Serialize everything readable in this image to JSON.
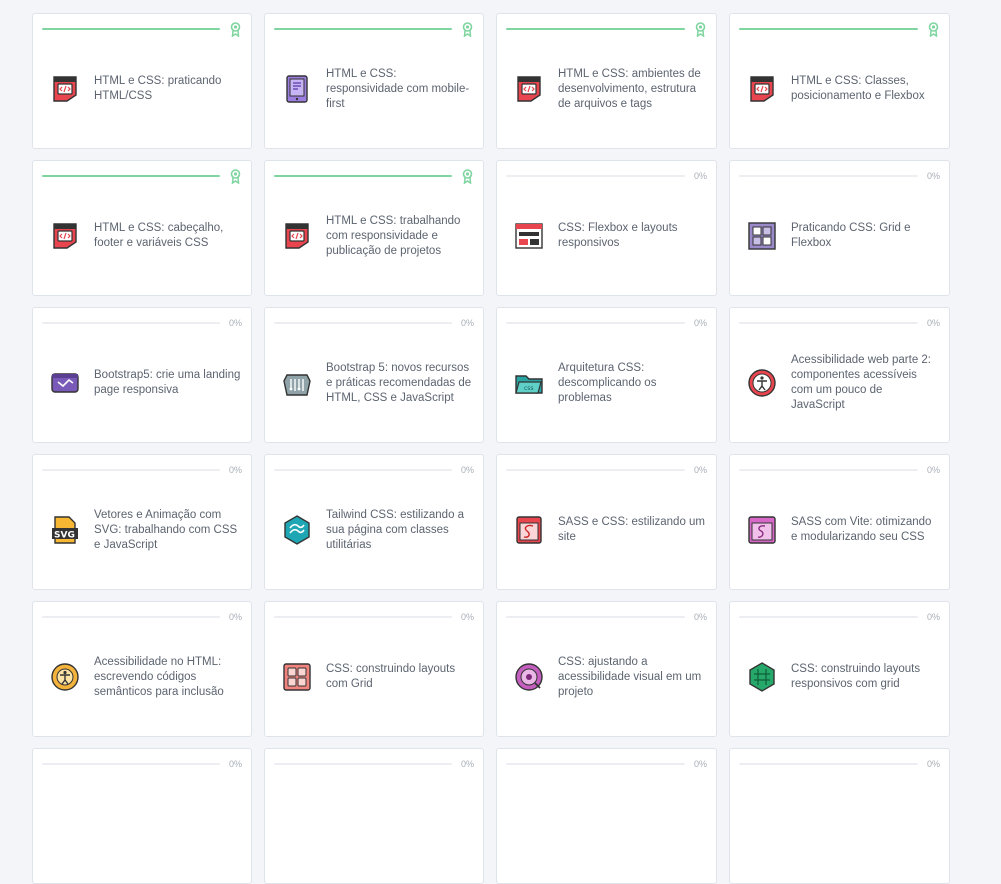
{
  "colors": {
    "progress_fill": "#7fd5a0",
    "track": "#eceef2",
    "percent_text": "#a7aeb8",
    "title_text": "#5c6470"
  },
  "courses": [
    {
      "title": "HTML e CSS: praticando HTML/CSS",
      "progress": 1,
      "percent": "",
      "icon": "html-code-icon",
      "completed": true
    },
    {
      "title": "HTML e CSS: responsividade com mobile-first",
      "progress": 1,
      "percent": "",
      "icon": "mobile-html-icon",
      "completed": true
    },
    {
      "title": "HTML e CSS: ambientes de desenvolvimento, estrutura de arquivos e tags",
      "progress": 1,
      "percent": "",
      "icon": "html-code-icon",
      "completed": true
    },
    {
      "title": "HTML e CSS: Classes, posicionamento e Flexbox",
      "progress": 1,
      "percent": "",
      "icon": "html-code-icon",
      "completed": true
    },
    {
      "title": "HTML e CSS: cabeçalho, footer e variáveis CSS",
      "progress": 1,
      "percent": "",
      "icon": "html-code-icon",
      "completed": true
    },
    {
      "title": "HTML e CSS: trabalhando com responsividade e publicação de projetos",
      "progress": 1,
      "percent": "",
      "icon": "html-code-icon",
      "completed": true
    },
    {
      "title": "CSS: Flexbox e layouts responsivos",
      "progress": 0,
      "percent": "0%",
      "icon": "layout-icon",
      "completed": false
    },
    {
      "title": "Praticando CSS: Grid e Flexbox",
      "progress": 0,
      "percent": "0%",
      "icon": "grid-flexbox-icon",
      "completed": false
    },
    {
      "title": "Bootstrap5: crie uma landing page responsiva",
      "progress": 0,
      "percent": "0%",
      "icon": "bootstrap-icon",
      "completed": false
    },
    {
      "title": "Bootstrap 5: novos recursos e práticas recomendadas de HTML, CSS e JavaScript",
      "progress": 0,
      "percent": "0%",
      "icon": "circuit-icon",
      "completed": false
    },
    {
      "title": "Arquitetura CSS: descomplicando os problemas",
      "progress": 0,
      "percent": "0%",
      "icon": "css-folder-icon",
      "completed": false
    },
    {
      "title": "Acessibilidade web parte 2: componentes acessíveis com um pouco de JavaScript",
      "progress": 0,
      "percent": "0%",
      "icon": "accessibility-person-icon",
      "completed": false
    },
    {
      "title": "Vetores e Animação com SVG: trabalhando com CSS e JavaScript",
      "progress": 0,
      "percent": "0%",
      "icon": "svg-file-icon",
      "completed": false
    },
    {
      "title": "Tailwind CSS: estilizando a sua página com classes utilitárias",
      "progress": 0,
      "percent": "0%",
      "icon": "tailwind-icon",
      "completed": false
    },
    {
      "title": "SASS e CSS: estilizando um site",
      "progress": 0,
      "percent": "0%",
      "icon": "sass-window-icon",
      "completed": false
    },
    {
      "title": "SASS com Vite: otimizando e modularizando seu CSS",
      "progress": 0,
      "percent": "0%",
      "icon": "sass-vite-icon",
      "completed": false
    },
    {
      "title": "Acessibilidade no HTML: escrevendo códigos semânticos para inclusão",
      "progress": 0,
      "percent": "0%",
      "icon": "accessibility-circle-icon",
      "completed": false
    },
    {
      "title": "CSS: construindo layouts com Grid",
      "progress": 0,
      "percent": "0%",
      "icon": "css-grid-icon",
      "completed": false
    },
    {
      "title": "CSS: ajustando a acessibilidade visual em um projeto",
      "progress": 0,
      "percent": "0%",
      "icon": "visual-accessibility-icon",
      "completed": false
    },
    {
      "title": "CSS: construindo layouts responsivos com grid",
      "progress": 0,
      "percent": "0%",
      "icon": "hex-grid-icon",
      "completed": false
    },
    {
      "title": "",
      "progress": 0,
      "percent": "0%",
      "icon": "",
      "completed": false
    },
    {
      "title": "",
      "progress": 0,
      "percent": "0%",
      "icon": "",
      "completed": false
    },
    {
      "title": "",
      "progress": 0,
      "percent": "0%",
      "icon": "",
      "completed": false
    },
    {
      "title": "",
      "progress": 0,
      "percent": "0%",
      "icon": "",
      "completed": false
    }
  ]
}
